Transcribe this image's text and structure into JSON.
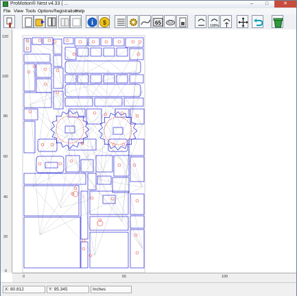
{
  "window": {
    "title": "ProMotion® Nest v4.33 ( ..."
  },
  "menu": [
    "File",
    "View",
    "Tools",
    "Options",
    "Registration",
    "Help"
  ],
  "toolbar": {
    "buttons": [
      "new-icon",
      "open-icon",
      "layout-icon",
      "single-view-icon",
      "info-icon",
      "dollar-icon",
      "parts-list-icon",
      "gear-icon",
      "curve-icon",
      "count-icon",
      "disk-icon",
      "nest-report-icon",
      "zoom-out-icon",
      "zoom-100-icon",
      "zoom-fit-icon",
      "pan-icon",
      "undo-icon",
      "bucket-icon"
    ],
    "count_label": "65",
    "zoom_label": "100%"
  },
  "rulers": {
    "vertical_ticks": [
      "120",
      "100",
      "80",
      "60",
      "40",
      "20",
      "0"
    ],
    "horizontal_ticks": [
      "0",
      "50",
      "100"
    ]
  },
  "status": {
    "x": "X: 80.812",
    "y": "Y: 95.345",
    "units": "Inches"
  },
  "colors": {
    "part_outline": "#2b2bd6",
    "hole_outline": "#e0453a",
    "toolpath": "#b9bcc6"
  }
}
